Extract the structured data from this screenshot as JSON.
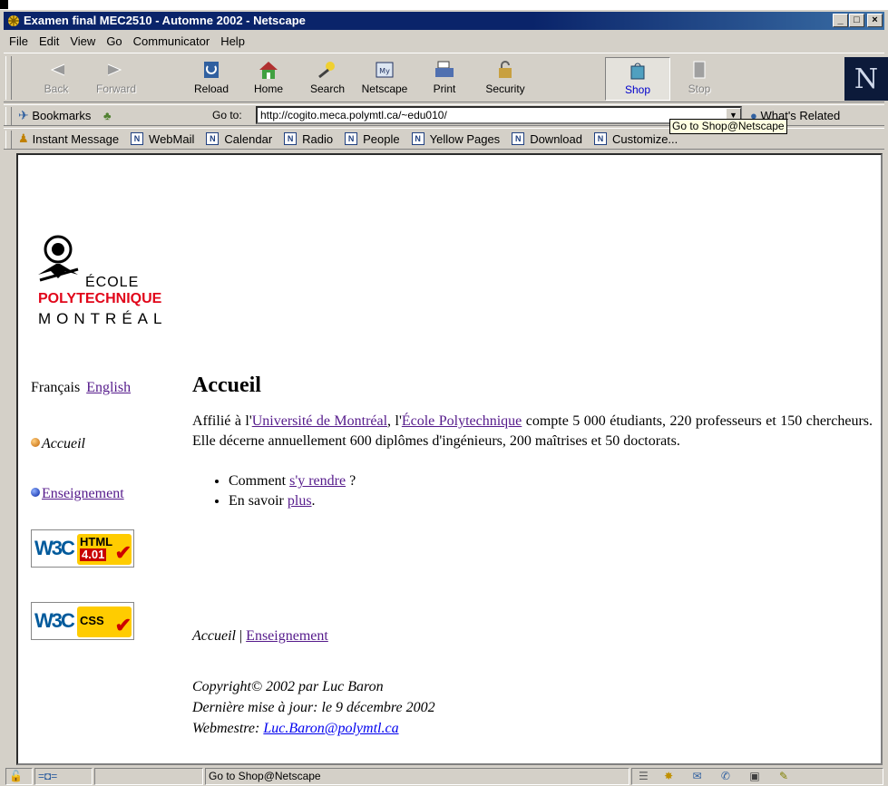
{
  "window": {
    "title": "Examen final MEC2510 - Automne 2002 - Netscape",
    "controls": {
      "minimize": "_",
      "maximize": "□",
      "close": "×"
    }
  },
  "menu": [
    "File",
    "Edit",
    "View",
    "Go",
    "Communicator",
    "Help"
  ],
  "toolbar": {
    "back": "Back",
    "forward": "Forward",
    "reload": "Reload",
    "home": "Home",
    "search": "Search",
    "netscape": "Netscape",
    "print": "Print",
    "security": "Security",
    "shop": "Shop",
    "stop": "Stop"
  },
  "location": {
    "bookmarks": "Bookmarks",
    "goto": "Go to:",
    "url": "http://cogito.meca.polymtl.ca/~edu010/",
    "related": "What's Related",
    "tooltip": "Go to Shop@Netscape"
  },
  "personal": [
    "Instant Message",
    "WebMail",
    "Calendar",
    "Radio",
    "People",
    "Yellow Pages",
    "Download",
    "Customize..."
  ],
  "page": {
    "logo": {
      "ecole": "ÉCOLE",
      "poly": "POLYTECHNIQUE",
      "mtl": "MONTRÉAL"
    },
    "lang": {
      "fr": "Français",
      "en": "English"
    },
    "nav": {
      "accueil": "Accueil",
      "enseignement": "Enseignement"
    },
    "badges": {
      "html": "HTML",
      "html_version": "4.01",
      "css": "CSS",
      "w3c": "W3C"
    },
    "heading": "Accueil",
    "intro": {
      "p1": "Affilié à l'",
      "link_udem": "Université de Montréal",
      "p2": ", l'",
      "link_poly": "École Polytechnique",
      "p3": " compte 5 000 étudiants, 220 professeurs et 150 chercheurs. Elle décerne annuellement 600 diplômes d'ingénieurs, 200 maîtrises et 50 doctorats."
    },
    "bullets": {
      "b1_pre": "Comment ",
      "b1_link": "s'y rendre",
      "b1_post": " ?",
      "b2_pre": "En savoir ",
      "b2_link": "plus",
      "b2_post": "."
    },
    "footer": {
      "accueil": "Accueil",
      "sep": " | ",
      "enseignement": "Enseignement"
    },
    "copyright": {
      "line1": "Copyright© 2002 par Luc Baron",
      "line2": "Dernière mise à jour: le 9 décembre 2002",
      "line3_pre": "Webmestre: ",
      "email": "Luc.Baron@polymtl.ca"
    }
  },
  "status": {
    "text": "Go to Shop@Netscape"
  }
}
